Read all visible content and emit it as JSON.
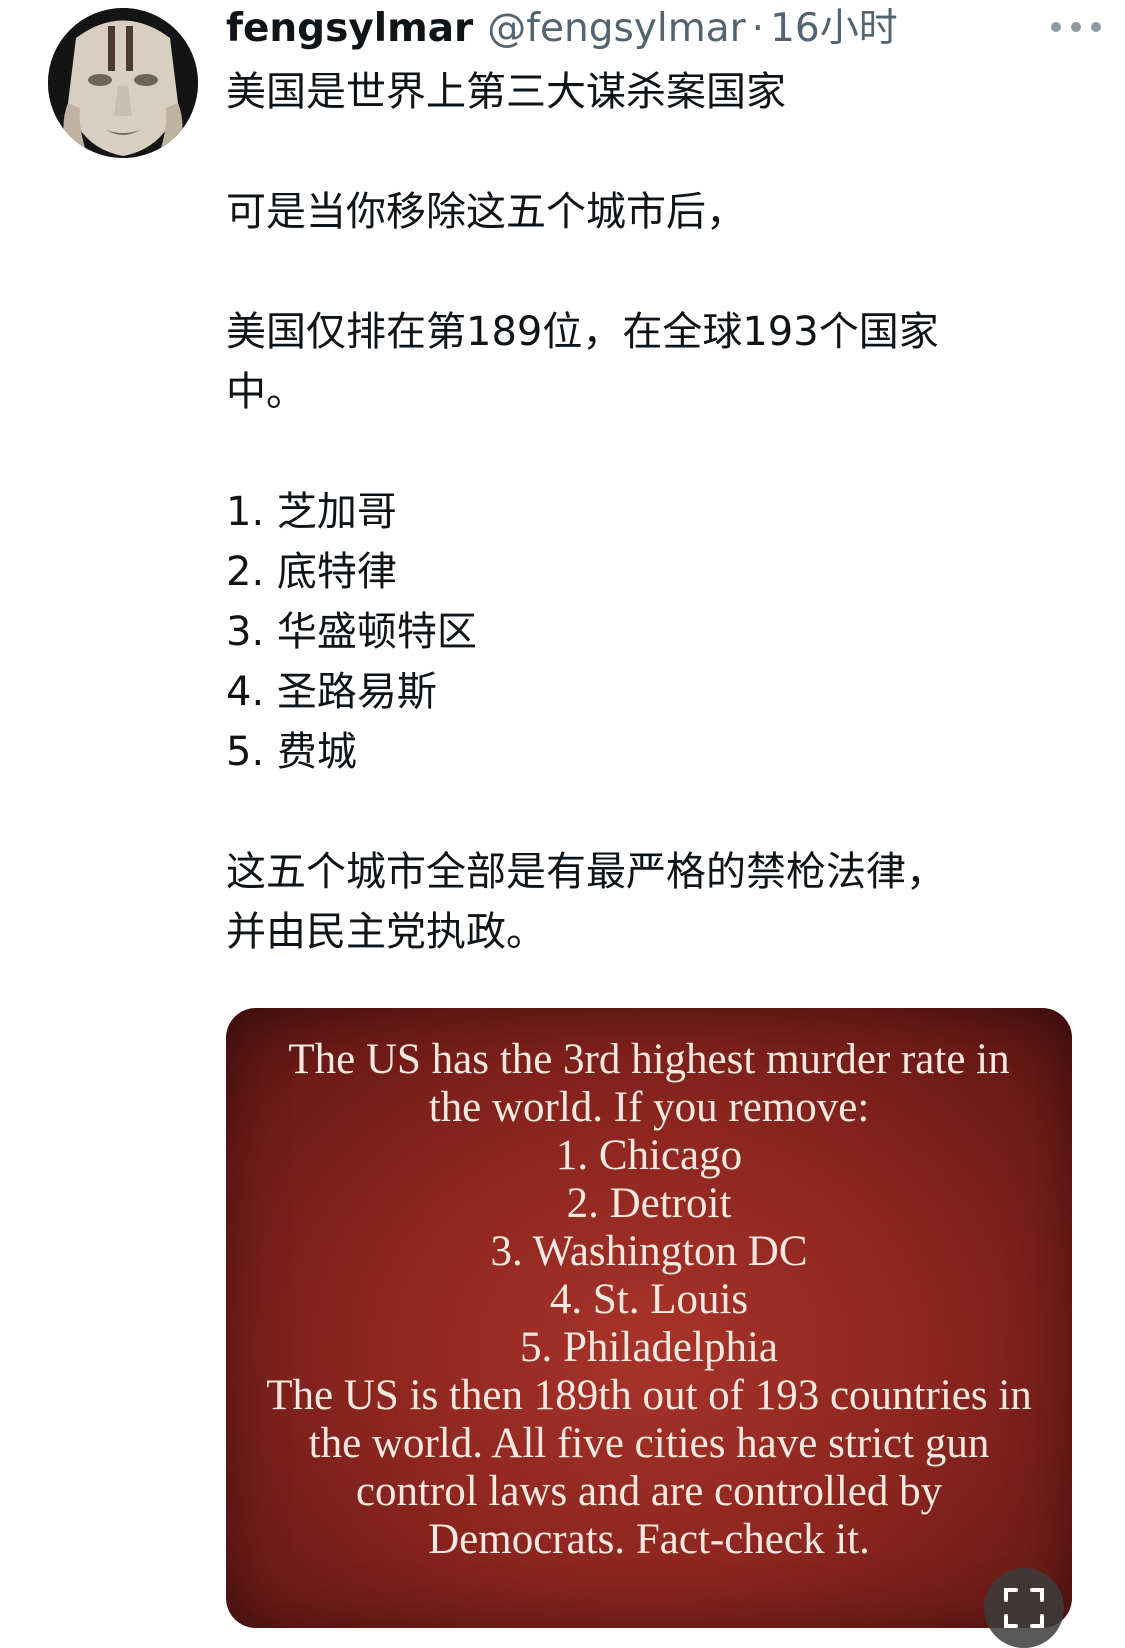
{
  "author": {
    "display_name": "fengsylmar",
    "handle": "@fengsylmar",
    "separator": "·",
    "time": "16小时"
  },
  "icons": {
    "avatar": "carved-mask-avatar",
    "more": "more-dots-icon",
    "expand": "expand-icon"
  },
  "tweet": {
    "line1": "美国是世界上第三大谋杀案国家",
    "line2": "可是当你移除这五个城市后，",
    "line3": "美国仅排在第189位，在全球193个国家",
    "line4": "中。",
    "list": [
      "1. 芝加哥",
      "2. 底特律",
      "3. 华盛顿特区",
      "4. 圣路易斯",
      "5. 费城"
    ],
    "line5": "这五个城市全部是有最严格的禁枪法律，",
    "line6": "并由民主党执政。"
  },
  "media": {
    "lines": [
      "The US has the 3rd highest murder rate in",
      "the world. If you remove:",
      "1. Chicago",
      "2. Detroit",
      "3. Washington DC",
      "4. St. Louis",
      "5. Philadelphia",
      "The US is then 189th out of 193 countries in",
      "the world. All five cities have strict gun",
      "control laws and are controlled by",
      "Democrats. Fact-check it."
    ]
  }
}
